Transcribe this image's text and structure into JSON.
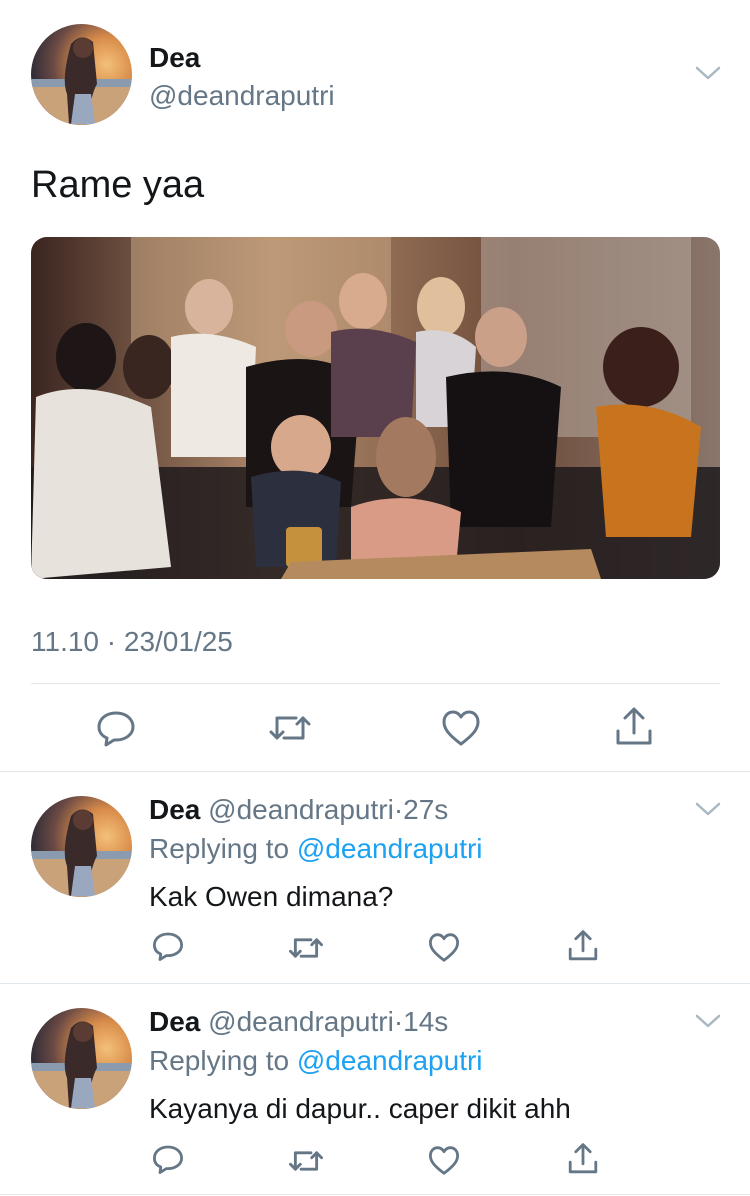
{
  "main_tweet": {
    "name": "Dea",
    "handle": "@deandraputri",
    "text": "Rame yaa",
    "timestamp": "11.10 · 23/01/25"
  },
  "replies": [
    {
      "name": "Dea",
      "handle": "@deandraputri",
      "separator": "·",
      "time": "27s",
      "replying_prefix": "Replying to",
      "replying_to": "@deandraputri",
      "text": "Kak Owen dimana?"
    },
    {
      "name": "Dea",
      "handle": "@deandraputri",
      "separator": "·",
      "time": "14s",
      "replying_prefix": "Replying to",
      "replying_to": "@deandraputri",
      "text": "Kayanya di dapur.. caper dikit ahh"
    }
  ],
  "actions": [
    "reply-icon",
    "retweet-icon",
    "like-icon",
    "share-icon"
  ],
  "colors": {
    "accent": "#1da1f2",
    "muted": "#657786",
    "divider": "#e1e8ed"
  }
}
